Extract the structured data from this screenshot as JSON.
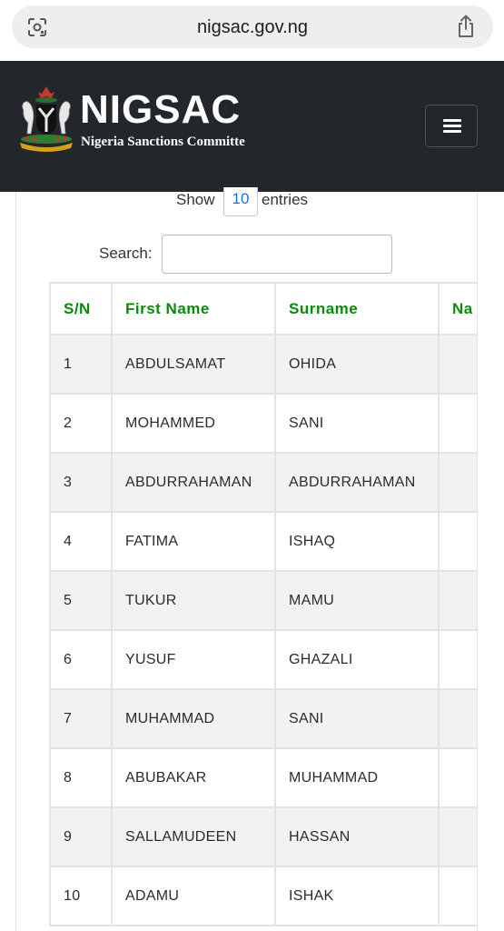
{
  "browser": {
    "url": "nigsac.gov.ng"
  },
  "header": {
    "brand_name": "NIGSAC",
    "brand_tagline": "Nigeria Sanctions Committe"
  },
  "controls": {
    "show_label": "Show",
    "entries_value": "10",
    "entries_label": "entries",
    "search_label": "Search:",
    "search_value": ""
  },
  "table": {
    "columns": [
      "S/N",
      "First Name",
      "Surname",
      "Na"
    ],
    "rows": [
      {
        "sn": "1",
        "first": "ABDULSAMAT",
        "surname": "OHIDA"
      },
      {
        "sn": "2",
        "first": "MOHAMMED",
        "surname": "SANI"
      },
      {
        "sn": "3",
        "first": "ABDURRAHAMAN",
        "surname": "ABDURRAHAMAN"
      },
      {
        "sn": "4",
        "first": "FATIMA",
        "surname": "ISHAQ"
      },
      {
        "sn": "5",
        "first": "TUKUR",
        "surname": "MAMU"
      },
      {
        "sn": "6",
        "first": "YUSUF",
        "surname": "GHAZALI"
      },
      {
        "sn": "7",
        "first": "MUHAMMAD",
        "surname": "SANI"
      },
      {
        "sn": "8",
        "first": "ABUBAKAR",
        "surname": "MUHAMMAD"
      },
      {
        "sn": "9",
        "first": "SALLAMUDEEN",
        "surname": "HASSAN"
      },
      {
        "sn": "10",
        "first": "ADAMU",
        "surname": "ISHAK"
      }
    ]
  },
  "colors": {
    "header_bg": "#23272b",
    "column_header_text": "#0a8a0a",
    "stripe": "#f2f2f2",
    "link_blue": "#1a73e8"
  },
  "icons": [
    "lens-icon",
    "share-icon",
    "coat-of-arms-logo",
    "hamburger-menu-icon"
  ]
}
